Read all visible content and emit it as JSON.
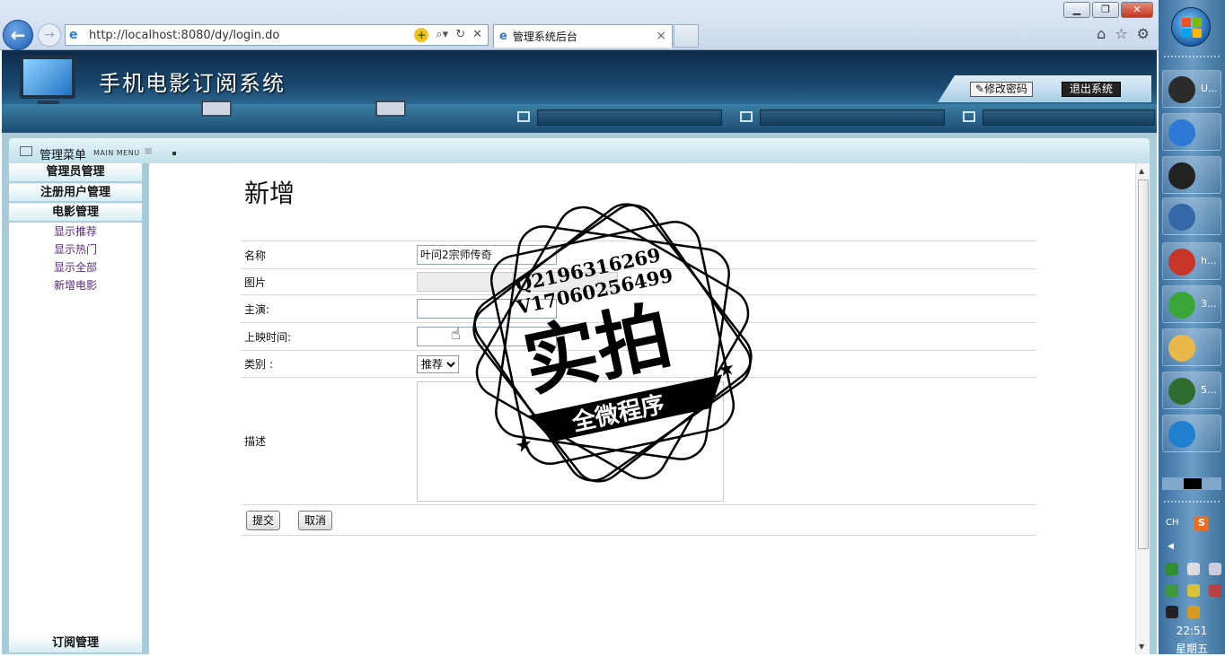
{
  "browser": {
    "url": "http://localhost:8080/dy/login.do",
    "tab_title": "管理系统后台",
    "tab_close": "×",
    "back_glyph": "←",
    "forward_glyph": "→",
    "icons": [
      "home-icon",
      "favorites-star-icon",
      "settings-gear-icon"
    ]
  },
  "header": {
    "app_title": "手机电影订阅系统",
    "change_password": "修改密码",
    "logout": "退出系统"
  },
  "menu": {
    "title": "管理菜单",
    "subtitle": "MAIN MENU",
    "sections": [
      {
        "label": "管理员管理"
      },
      {
        "label": "注册用户管理"
      },
      {
        "label": "电影管理"
      }
    ],
    "movie_links": [
      "显示推荐",
      "显示热门",
      "显示全部",
      "新增电影"
    ],
    "bottom_section": "订阅管理"
  },
  "form": {
    "page_title": "新增",
    "name_label": "名称",
    "name_value": "叶问2宗师传奇",
    "image_label": "图片",
    "actor_label": "主演:",
    "actor_value": "",
    "release_label": "上映时间:",
    "release_value": "",
    "category_label": "类别 :",
    "category_selected": "推荐",
    "desc_label": "描述",
    "desc_value": "",
    "submit_label": "提交",
    "cancel_label": "取消"
  },
  "watermark": {
    "contact_q": "Q2196316269",
    "contact_v": "V17060256499",
    "big_text": "实拍",
    "banner_text": "全微程序"
  },
  "taskbar": {
    "items": [
      {
        "icon": "ultraedit-icon",
        "label": "U...",
        "color": "#2b2b2b"
      },
      {
        "icon": "internet-explorer-icon",
        "label": "",
        "color": "#2d79d4"
      },
      {
        "icon": "qq-penguin-icon",
        "label": "",
        "color": "#222222"
      },
      {
        "icon": "remote-desktop-icon",
        "label": "",
        "color": "#3568a8"
      },
      {
        "icon": "app-avatar-icon",
        "label": "h...",
        "color": "#c8362a"
      },
      {
        "icon": "green-sync-icon",
        "label": "3...",
        "color": "#3aa63a"
      },
      {
        "icon": "folder-icon",
        "label": "",
        "color": "#e8b84a"
      },
      {
        "icon": "amd-icon",
        "label": "5...",
        "color": "#2f6d2f"
      },
      {
        "icon": "kugou-icon",
        "label": "",
        "color": "#1f7fd1"
      }
    ],
    "lang": "CH",
    "ime": "S",
    "clock": "22:51",
    "weekday": "星期五"
  }
}
